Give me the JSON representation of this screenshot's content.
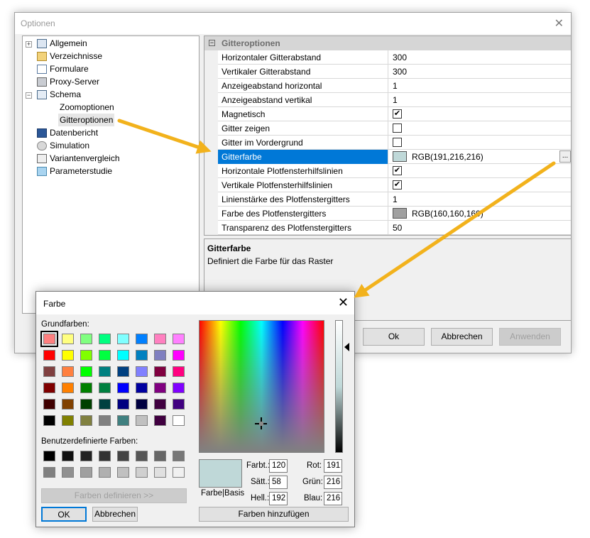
{
  "options": {
    "title": "Optionen",
    "tree": [
      "Allgemein",
      "Verzeichnisse",
      "Formulare",
      "Proxy-Server",
      "Schema",
      "Zoomoptionen",
      "Gitteroptionen",
      "Datenbericht",
      "Simulation",
      "Variantenvergleich",
      "Parameterstudie"
    ],
    "grid": {
      "header": "Gitteroptionen",
      "rows": [
        {
          "k": "Horizontaler Gitterabstand",
          "v": "300"
        },
        {
          "k": "Vertikaler Gitterabstand",
          "v": "300"
        },
        {
          "k": "Anzeigeabstand horizontal",
          "v": "1"
        },
        {
          "k": "Anzeigeabstand vertikal",
          "v": "1"
        },
        {
          "k": "Magnetisch",
          "v": "✔"
        },
        {
          "k": "Gitter zeigen",
          "v": ""
        },
        {
          "k": "Gitter im Vordergrund",
          "v": ""
        },
        {
          "k": "Gitterfarbe",
          "v": "RGB(191,216,216)"
        },
        {
          "k": "Horizontale Plotfensterhilfslinien",
          "v": "✔"
        },
        {
          "k": "Vertikale Plotfensterhilfslinien",
          "v": "✔"
        },
        {
          "k": "Linienstärke des Plotfenstergitters",
          "v": "1"
        },
        {
          "k": "Farbe des Plotfenstergitters",
          "v": "RGB(160,160,160)"
        },
        {
          "k": "Transparenz des Plotfenstergitters",
          "v": "50"
        }
      ],
      "ellipsis": "..."
    },
    "desc_title": "Gitterfarbe",
    "desc_text": "Definiert die Farbe für das Raster",
    "ok": "Ok",
    "cancel": "Abbrechen",
    "apply": "Anwenden"
  },
  "color": {
    "title": "Farbe",
    "basic_label": "Grundfarben:",
    "custom_label": "Benutzerdefinierte Farben:",
    "define_button": "Farben definieren >>",
    "ok": "OK",
    "cancel": "Abbrechen",
    "add_button": "Farben hinzufügen",
    "preview_label": "Farbe|Basis",
    "hue_label": "Farbt.:",
    "hue": "120",
    "sat_label": "Sätt.:",
    "sat": "58",
    "lum_label": "Hell.:",
    "lum": "192",
    "red_label": "Rot:",
    "red": "191",
    "green_label": "Grün:",
    "green": "216",
    "blue_label": "Blau:",
    "blue": "216",
    "basic_colors": [
      "#ff8080",
      "#ffff80",
      "#80ff80",
      "#00ff80",
      "#80ffff",
      "#0080ff",
      "#ff80c0",
      "#ff80ff",
      "#ff0000",
      "#ffff00",
      "#80ff00",
      "#00ff40",
      "#00ffff",
      "#0080c0",
      "#8080c0",
      "#ff00ff",
      "#804040",
      "#ff8040",
      "#00ff00",
      "#008080",
      "#004080",
      "#8080ff",
      "#800040",
      "#ff0080",
      "#800000",
      "#ff8000",
      "#008000",
      "#008040",
      "#0000ff",
      "#0000a0",
      "#800080",
      "#8000ff",
      "#400000",
      "#804000",
      "#004000",
      "#004040",
      "#000080",
      "#000040",
      "#400040",
      "#400080",
      "#000000",
      "#808000",
      "#808040",
      "#808080",
      "#408080",
      "#c0c0c0",
      "#400040",
      "#ffffff"
    ],
    "custom_colors": [
      "#000000",
      "#111111",
      "#222222",
      "#333333",
      "#444444",
      "#555555",
      "#666666",
      "#777777",
      "#808080",
      "#909090",
      "#a0a0a0",
      "#b0b0b0",
      "#c0c0c0",
      "#d0d0d0",
      "#e0e0e0",
      "#f0f0f0"
    ],
    "selected_color": "#bfd8d8"
  }
}
